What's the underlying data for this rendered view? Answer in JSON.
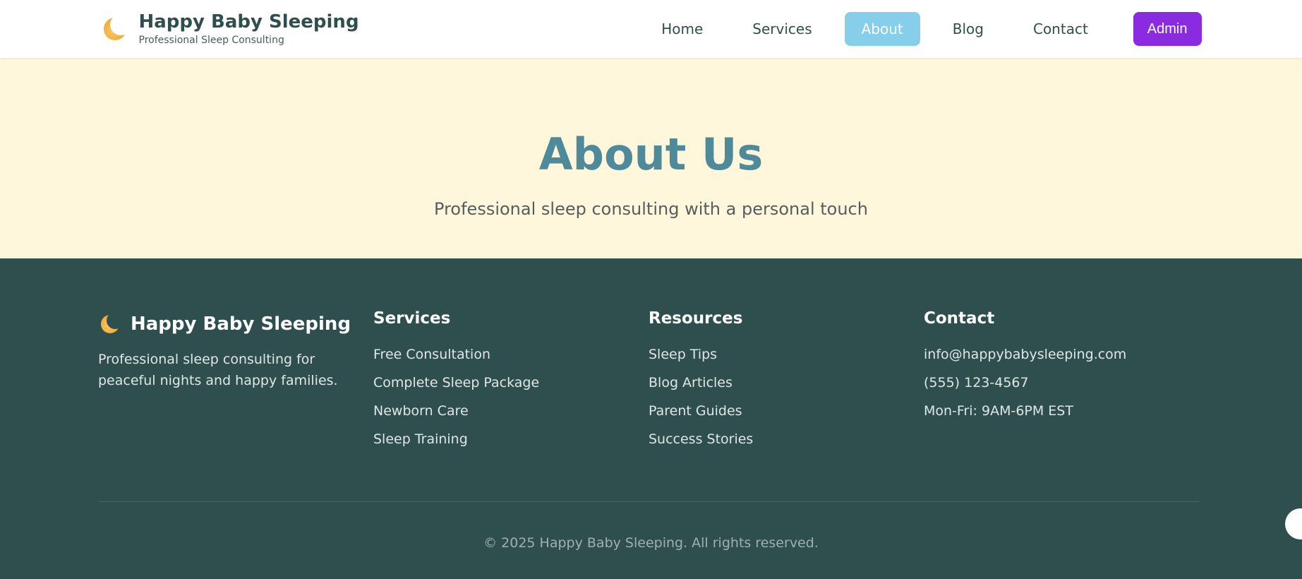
{
  "header": {
    "brand_title": "Happy Baby Sleeping",
    "brand_subtitle": "Professional Sleep Consulting",
    "logo_icon": "crescent-moon-icon",
    "nav": [
      {
        "label": "Home",
        "active": false
      },
      {
        "label": "Services",
        "active": false
      },
      {
        "label": "About",
        "active": true
      },
      {
        "label": "Blog",
        "active": false
      },
      {
        "label": "Contact",
        "active": false
      }
    ],
    "admin_label": "Admin"
  },
  "hero": {
    "title": "About Us",
    "subtitle": "Professional sleep consulting with a personal touch"
  },
  "footer": {
    "brand_title": "Happy Baby Sleeping",
    "description": "Professional sleep consulting for peaceful nights and happy families.",
    "services": {
      "heading": "Services",
      "links": [
        "Free Consultation",
        "Complete Sleep Package",
        "Newborn Care",
        "Sleep Training"
      ]
    },
    "resources": {
      "heading": "Resources",
      "links": [
        "Sleep Tips",
        "Blog Articles",
        "Parent Guides",
        "Success Stories"
      ]
    },
    "contact": {
      "heading": "Contact",
      "items": [
        "info@happybabysleeping.com",
        "(555) 123-4567",
        "Mon-Fri: 9AM-6PM EST"
      ]
    },
    "copyright": "© 2025 Happy Baby Sleeping. All rights reserved."
  },
  "colors": {
    "primary_dark": "#2f4f4f",
    "nav_active": "#87ceeb",
    "admin": "#8a2be2",
    "hero_bg": "#fff7dc",
    "hero_title": "#4f8a9b"
  }
}
